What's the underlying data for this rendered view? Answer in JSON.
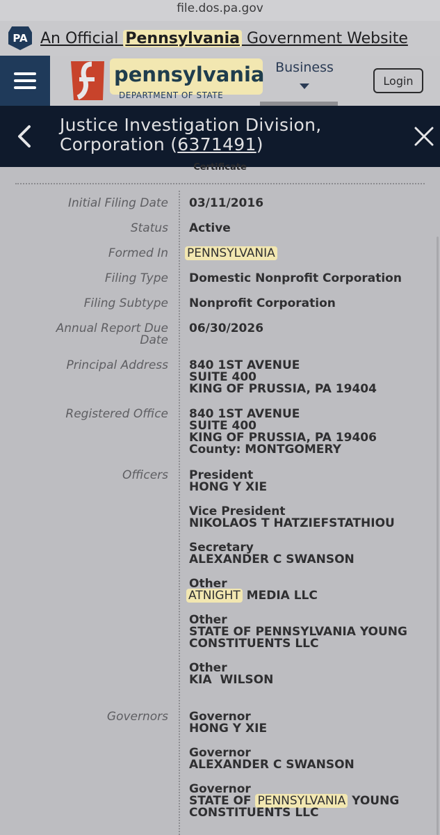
{
  "browser": {
    "url": "file.dos.pa.gov"
  },
  "banner": {
    "badge": "PA",
    "prefix": "An Official ",
    "highlight": "Pennsylvania",
    "suffix": " Government Website"
  },
  "nav": {
    "logo_name": "pennsylvania",
    "logo_sub": "DEPARTMENT OF STATE",
    "business_label": "Business",
    "login_label": "Login"
  },
  "record": {
    "title_line1": "Justice Investigation Division,",
    "title_line2_prefix": "Corporation (",
    "title_number": "6371491",
    "title_line2_suffix": ")",
    "certificate_label": "Certificate"
  },
  "details": {
    "initial_filing_date": {
      "label": "Initial Filing Date",
      "value": "03/11/2016"
    },
    "status": {
      "label": "Status",
      "value": "Active"
    },
    "formed_in": {
      "label": "Formed In",
      "value": "PENNSYLVANIA"
    },
    "filing_type": {
      "label": "Filing Type",
      "value": "Domestic Nonprofit Corporation"
    },
    "filing_subtype": {
      "label": "Filing Subtype",
      "value": "Nonprofit Corporation"
    },
    "annual_report": {
      "label_line1": "Annual Report Due",
      "label_line2": "Date",
      "value": "06/30/2026"
    },
    "principal_address": {
      "label": "Principal Address",
      "line1": "840 1ST AVENUE",
      "line2": "SUITE 400",
      "line3": "KING OF PRUSSIA, PA 19404"
    },
    "registered_office": {
      "label": "Registered Office",
      "line1": "840 1ST AVENUE",
      "line2": "SUITE 400",
      "line3": "KING OF PRUSSIA, PA 19406",
      "line4": "County: MONTGOMERY"
    },
    "officers": {
      "label": "Officers",
      "items": [
        {
          "role": "President",
          "name": "HONG Y XIE"
        },
        {
          "role": "Vice President",
          "name": "NIKOLAOS T HATZIEFSTATHIOU"
        },
        {
          "role": "Secretary",
          "name": "ALEXANDER C SWANSON"
        },
        {
          "role": "Other",
          "name_highlight": "ATNIGHT",
          "name_rest": " MEDIA LLC"
        },
        {
          "role": "Other",
          "name_line1": "STATE OF PENNSYLVANIA YOUNG",
          "name_line2": "CONSTITUENTS LLC"
        },
        {
          "role": "Other",
          "name": "KIA  WILSON"
        }
      ]
    },
    "governors": {
      "label": "Governors",
      "items": [
        {
          "role": "Governor",
          "name": "HONG Y XIE"
        },
        {
          "role": "Governor",
          "name": "ALEXANDER C SWANSON"
        },
        {
          "role": "Governor",
          "name_prefix": "STATE OF ",
          "name_highlight": "PENNSYLVANIA",
          "name_suffix": " YOUNG",
          "name_line2": "CONSTITUENTS LLC"
        }
      ]
    }
  },
  "colors": {
    "navy": "#1f3a5a",
    "highlight": "#f2e7b1",
    "dark_header": "#0f1a2c",
    "logo_red": "#c8432b"
  }
}
